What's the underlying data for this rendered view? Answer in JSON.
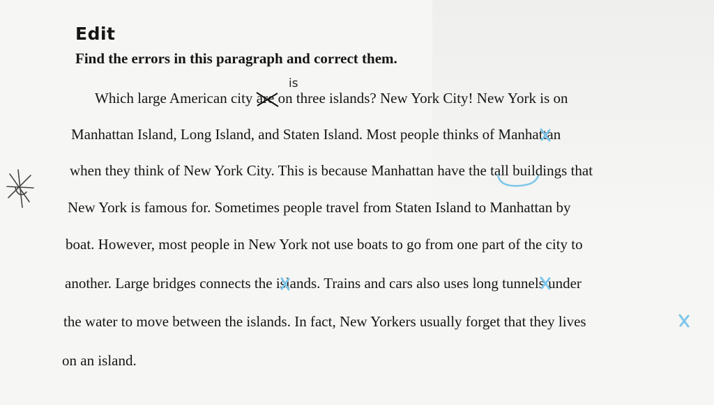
{
  "document": {
    "heading": "Edit",
    "instruction": "Find the errors in this paragraph and correct them.",
    "correction_insert": "is",
    "lines": [
      {
        "pre": "Which large American city ",
        "struck": "are",
        "post": " on three islands? New York City! New York is on"
      },
      {
        "text": "Manhattan Island, Long Island, and Staten Island. Most people thinks of Manhattan"
      },
      {
        "text": "when they think of New York City. This is because Manhattan have the tall buildings that"
      },
      {
        "text": "New York is famous for. Sometimes people travel from Staten Island to Manhattan by"
      },
      {
        "text": "boat. However, most people in New York not use boats to go from one part of the city to"
      },
      {
        "text": "another. Large bridges connects the islands. Trains and cars also uses long tunnels under"
      },
      {
        "text": "the water to move between the islands. In fact, New Yorkers usually forget that they lives"
      },
      {
        "text": "on an island."
      }
    ]
  },
  "annotations": {
    "ink_color": "#7cc6ea",
    "pencil_color": "#444444",
    "margin_mark": "star-doodle"
  }
}
